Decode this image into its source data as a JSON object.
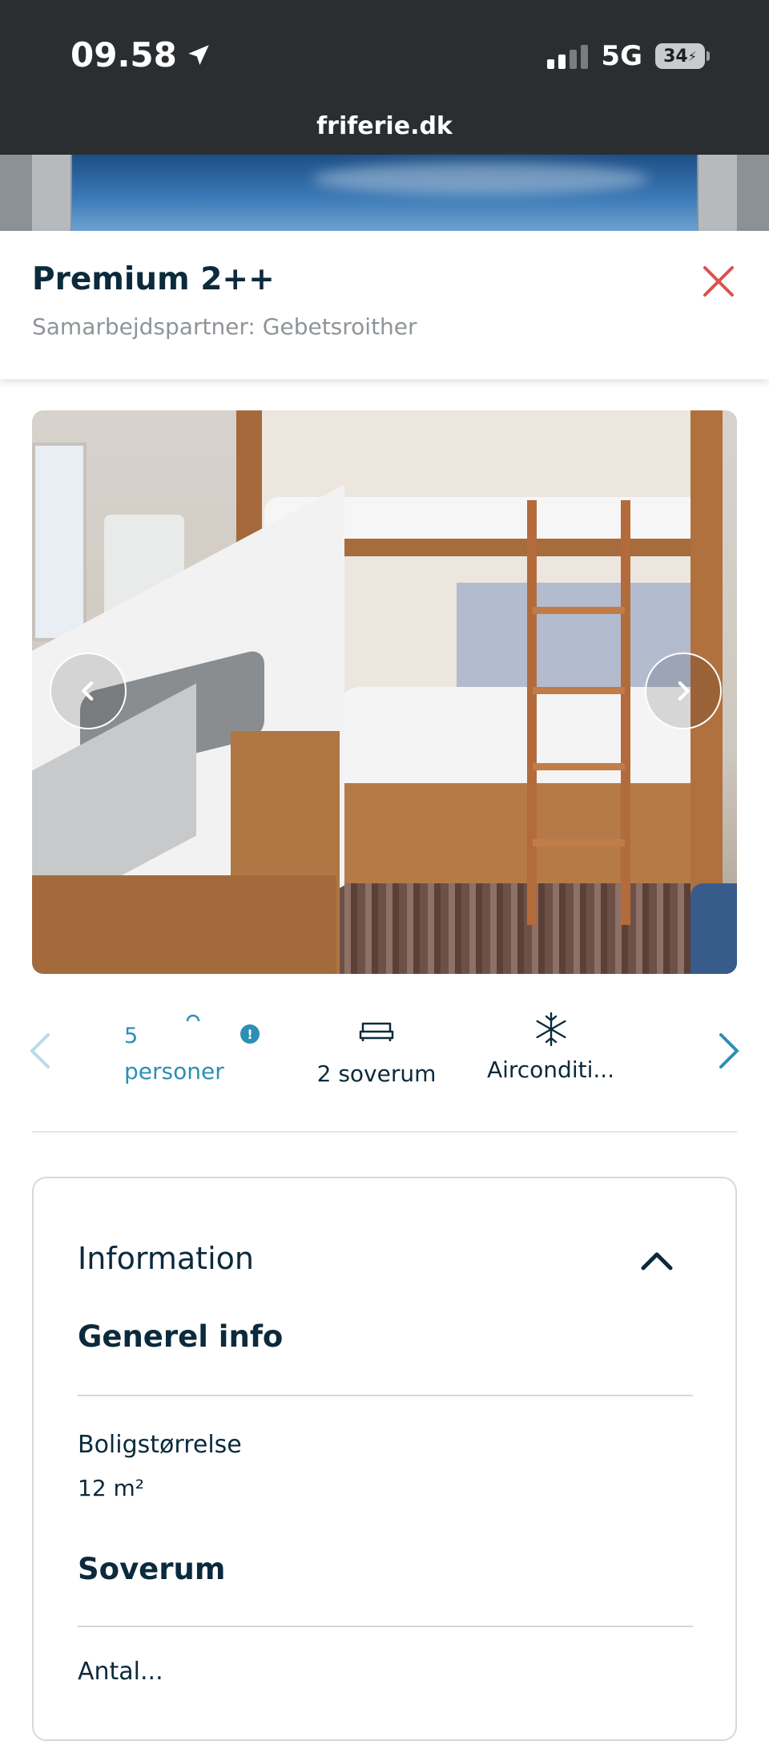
{
  "status_bar": {
    "time": "09.58",
    "network": "5G",
    "battery": "34"
  },
  "browser": {
    "url": "friferie.dk"
  },
  "header": {
    "title": "Premium 2++",
    "subtitle": "Samarbejdspartner: Gebetsroither"
  },
  "features": {
    "items": [
      {
        "value": "5",
        "label": "personer",
        "icon": "persons-icon",
        "color": "#2c8fb5"
      },
      {
        "label": "2 soverum",
        "icon": "bed-icon"
      },
      {
        "label": "Airconditi...",
        "icon": "snowflake-icon"
      }
    ],
    "info_badge": "!"
  },
  "info": {
    "heading": "Information",
    "sections": [
      {
        "title": "Generel info",
        "properties": [
          {
            "label": "Boligstørrelse",
            "value": "12 m²"
          }
        ]
      },
      {
        "title": "Soverum",
        "properties": [
          {
            "label": "Antal..."
          }
        ]
      }
    ]
  },
  "colors": {
    "accent": "#2c8fb5",
    "close": "#d9534f",
    "text": "#0b2a3c",
    "status_bg": "#2b2e31"
  }
}
